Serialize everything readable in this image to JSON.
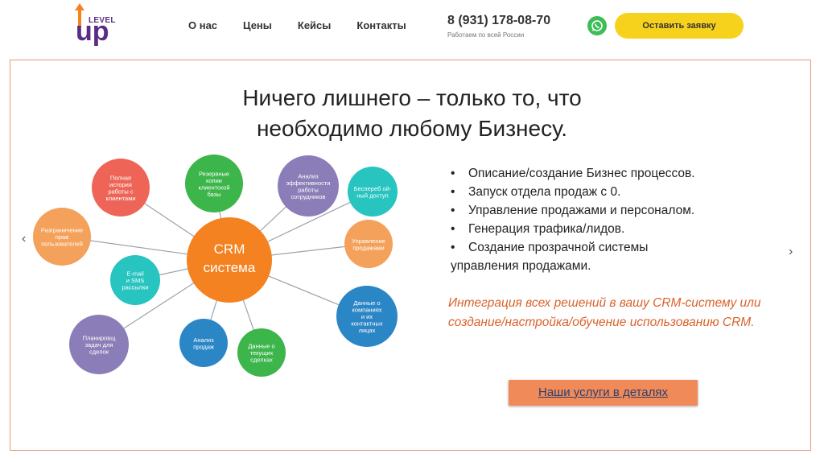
{
  "header": {
    "logo_level": "LEVEL",
    "logo_up": "up",
    "nav": [
      "О нас",
      "Цены",
      "Кейсы",
      "Контакты"
    ],
    "phone": "8 (931) 178-08-70",
    "phone_sub": "Работаем по всей России",
    "cta": "Оставить заявку"
  },
  "slide": {
    "title_line1": "Ничего лишнего – только то, что",
    "title_line2": "необходимо любому Бизнесу.",
    "prev_arrow": "‹",
    "next_arrow": "›"
  },
  "diagram": {
    "center": "CRM система",
    "center_line1": "CRM",
    "center_line2": "система",
    "nodes": [
      {
        "lines": [
          "Полная",
          "история",
          "работы с",
          "клиентами"
        ],
        "color": "#ee6557"
      },
      {
        "lines": [
          "Резервные",
          "копии",
          "клиентской",
          "базы"
        ],
        "color": "#3cb54a"
      },
      {
        "lines": [
          "Анализ",
          "эффективности",
          "работы",
          "сотрудников"
        ],
        "color": "#8b7eb8"
      },
      {
        "lines": [
          "Беспереб ой-",
          "ный доступ"
        ],
        "color": "#27c4c0"
      },
      {
        "lines": [
          "Разграничение",
          "прав",
          "пользователей"
        ],
        "color": "#f4a15b"
      },
      {
        "lines": [
          "Управление",
          "продажами"
        ],
        "color": "#f4a15b"
      },
      {
        "lines": [
          "E-mail",
          "и SMS",
          "рассылки"
        ],
        "color": "#27c4c0"
      },
      {
        "lines": [
          "Данные о",
          "компаниях",
          "и их",
          "контактных",
          "лицах"
        ],
        "color": "#2b86c6"
      },
      {
        "lines": [
          "Планировщ",
          "задач для",
          "сделок"
        ],
        "color": "#8b7eb8"
      },
      {
        "lines": [
          "Анализ",
          "продаж"
        ],
        "color": "#2b86c6"
      },
      {
        "lines": [
          "Данные о",
          "текущих",
          "сделках"
        ],
        "color": "#3cb54a"
      }
    ]
  },
  "bullets": [
    "Описание/создание Бизнес процессов.",
    "Запуск отдела продаж с 0.",
    "Управление продажами и персоналом.",
    "Генерация трафика/лидов.",
    "Создание прозрачной системы"
  ],
  "bullet_continuation": "управления продажами.",
  "bullet_marker": "•",
  "italic_text": "Интеграция всех решений в вашу CRM-систему или создание/настройка/обучение использованию CRM.",
  "services_button": "Наши услуги в деталях",
  "colors": {
    "cta": "#f7d21c",
    "whatsapp": "#3cbe57",
    "frame": "#e49a7b",
    "crm_center": "#f58220",
    "italic": "#d9622c",
    "services_bg": "#f18a59"
  }
}
